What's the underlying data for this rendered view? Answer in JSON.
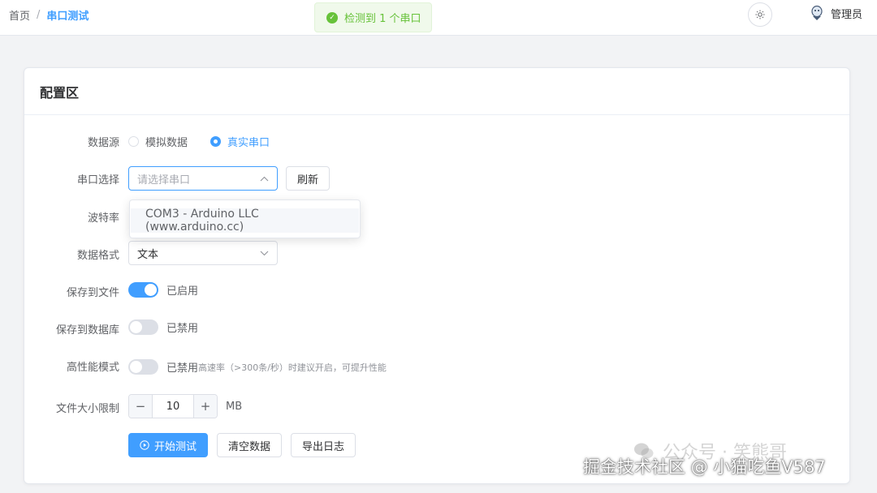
{
  "breadcrumb": {
    "home": "首页",
    "separator": "/",
    "current": "串口测试"
  },
  "toast": {
    "icon": "check-circle-icon",
    "text": "检测到 1 个串口"
  },
  "header": {
    "theme_icon": "sun-icon",
    "user_name": "管理员"
  },
  "card": {
    "title": "配置区"
  },
  "form": {
    "data_source": {
      "label": "数据源",
      "options": [
        "模拟数据",
        "真实串口"
      ],
      "selected": "真实串口"
    },
    "serial_port": {
      "label": "串口选择",
      "placeholder": "请选择串口",
      "refresh_label": "刷新",
      "dropdown_options": [
        "COM3 - Arduino LLC (www.arduino.cc)"
      ]
    },
    "baud_rate": {
      "label": "波特率"
    },
    "data_format": {
      "label": "数据格式",
      "value": "文本"
    },
    "save_file": {
      "label": "保存到文件",
      "state": "已启用",
      "on": true
    },
    "save_db": {
      "label": "保存到数据库",
      "state": "已禁用",
      "on": false
    },
    "high_perf": {
      "label": "高性能模式",
      "state": "已禁用",
      "on": false,
      "hint": "高速率（>300条/秒）时建议开启，可提升性能"
    },
    "file_size": {
      "label": "文件大小限制",
      "value": "10",
      "unit": "MB",
      "minus": "−",
      "plus": "+"
    }
  },
  "actions": {
    "start": "开始测试",
    "clear": "清空数据",
    "export": "导出日志"
  },
  "watermark": {
    "text": "掘金技术社区 @ 小猫吃鱼V587",
    "faint": "公众号 · 笑熊哥"
  },
  "colors": {
    "primary": "#409eff",
    "success": "#67c23a",
    "border": "#dcdfe6"
  }
}
